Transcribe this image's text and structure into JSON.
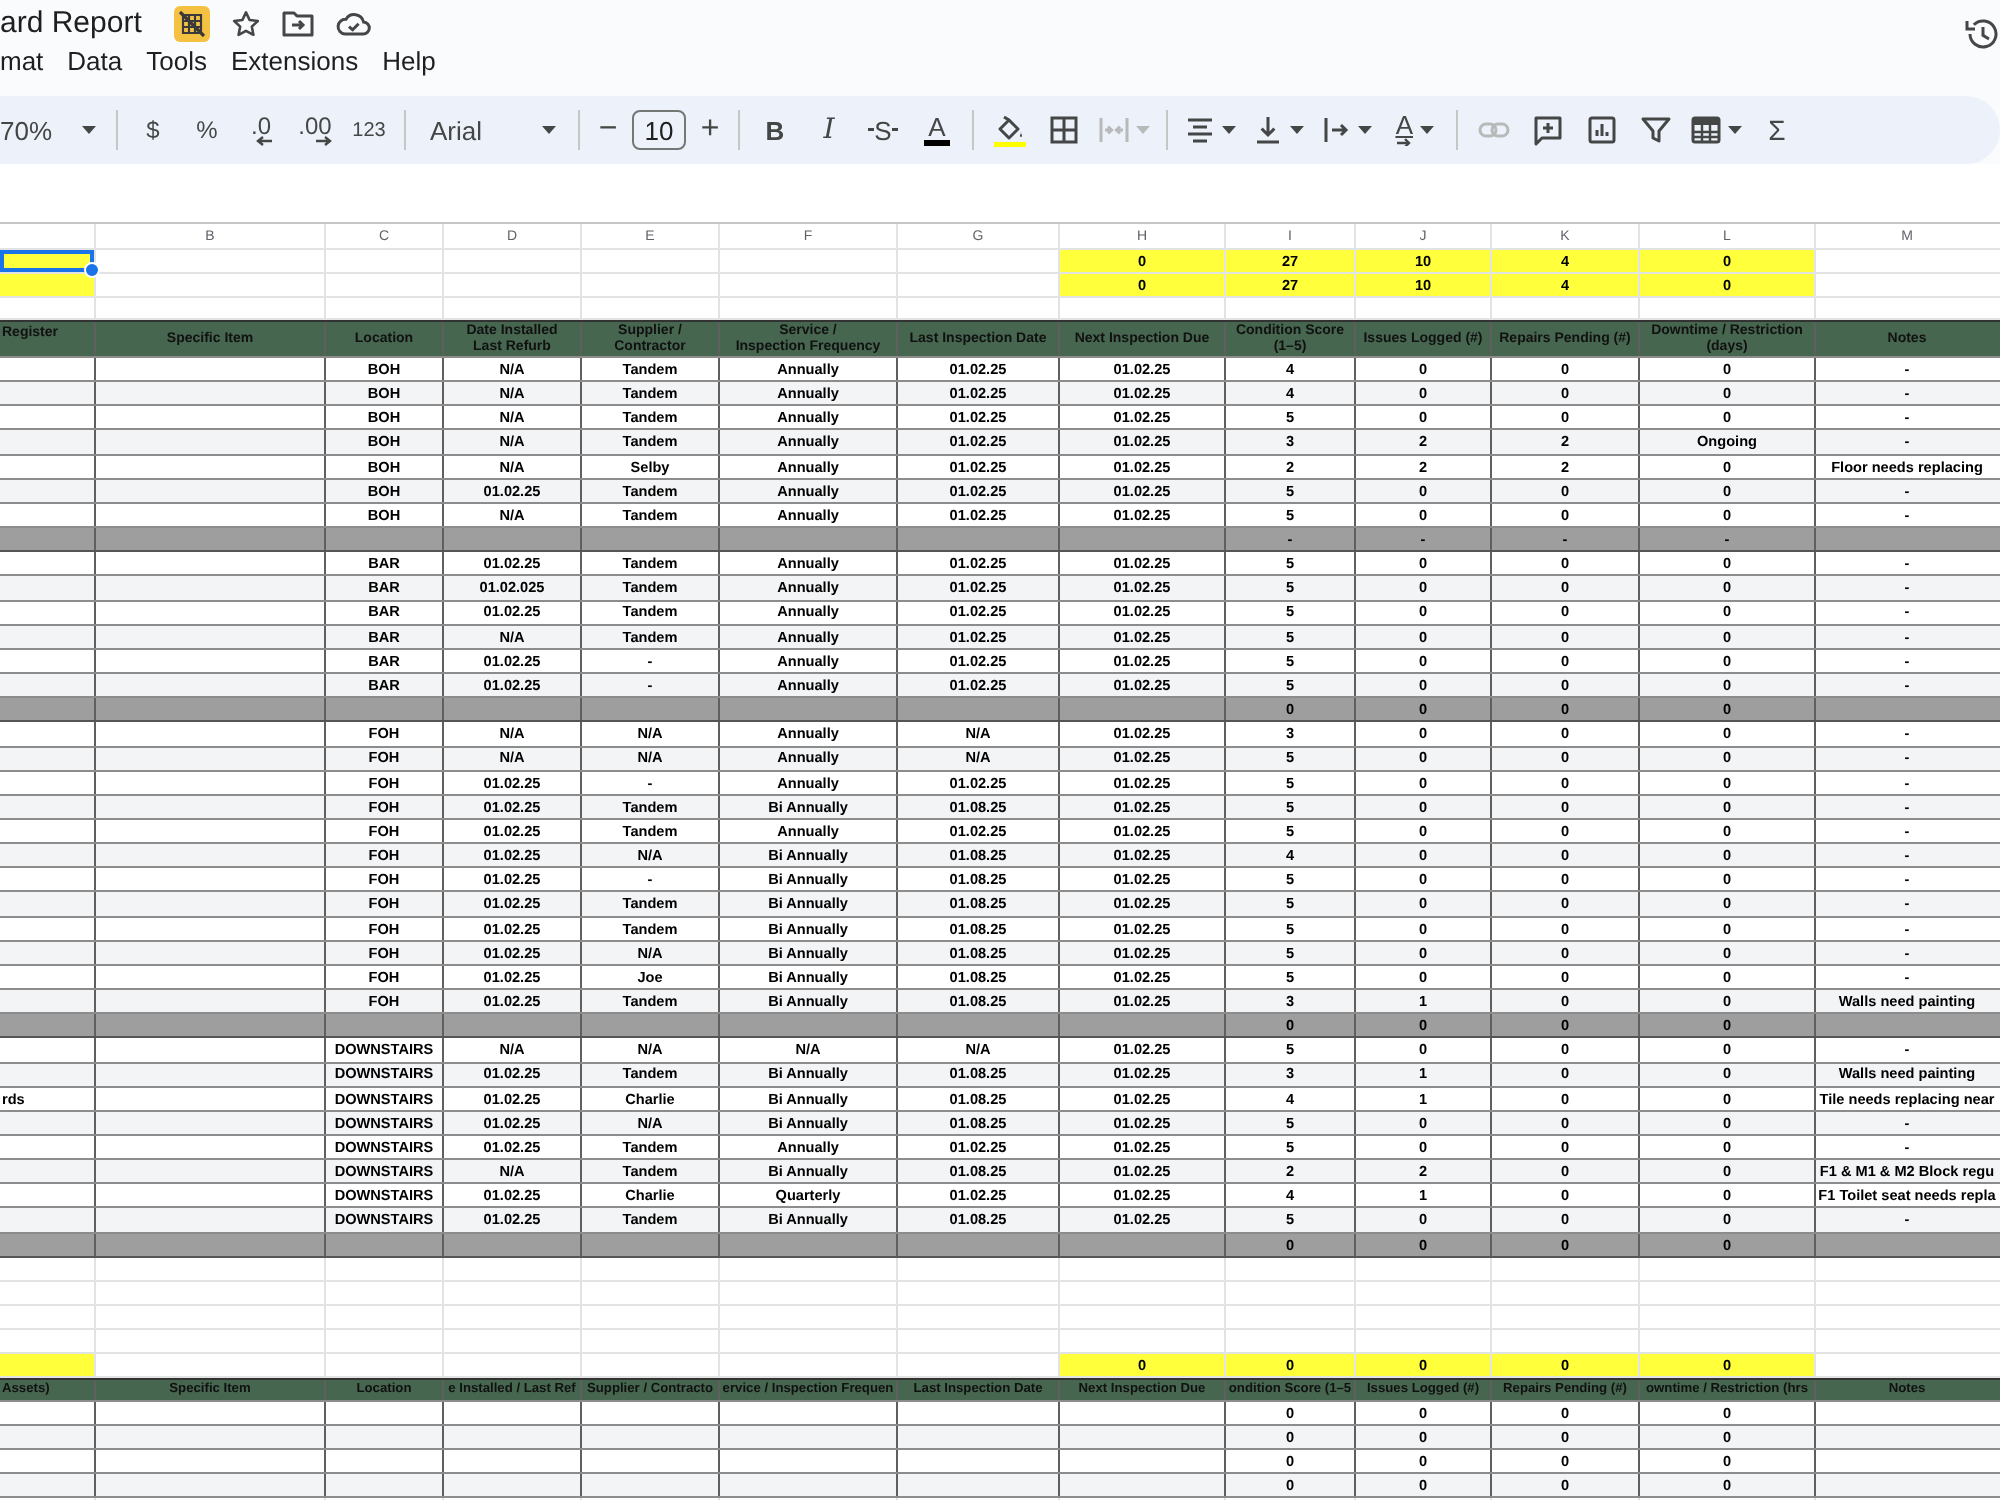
{
  "document": {
    "title": "ard Report"
  },
  "menu": [
    "mat",
    "Data",
    "Tools",
    "Extensions",
    "Help"
  ],
  "toolbar": [
    [
      {
        "kind": "zoom",
        "label": "70%",
        "dropdown": true,
        "disabled": false
      }
    ],
    [
      {
        "kind": "currency",
        "label": "$",
        "disabled": false
      },
      {
        "kind": "percent",
        "label": "%",
        "disabled": false
      },
      {
        "kind": "decimal_less",
        "label": ".0",
        "disabled": false
      },
      {
        "kind": "decimal_more",
        "label": ".00",
        "disabled": false
      },
      {
        "kind": "number_format",
        "label": "123",
        "disabled": false
      }
    ],
    [
      {
        "kind": "font",
        "label": "Arial",
        "dropdown": true,
        "disabled": false
      }
    ],
    [
      {
        "kind": "size_down",
        "label": "−",
        "disabled": false
      },
      {
        "kind": "size",
        "label": "10",
        "disabled": false
      },
      {
        "kind": "size_up",
        "label": "+",
        "disabled": false
      }
    ],
    [
      {
        "kind": "bold",
        "label": "B",
        "disabled": false
      },
      {
        "kind": "italic",
        "label": "I",
        "disabled": false
      },
      {
        "kind": "strike",
        "label": "S",
        "disabled": false
      },
      {
        "kind": "text_color",
        "label": "A",
        "disabled": false
      }
    ],
    [
      {
        "kind": "fill",
        "disabled": false
      },
      {
        "kind": "borders",
        "disabled": false
      },
      {
        "kind": "merge",
        "dropdown": true,
        "disabled": true
      }
    ],
    [
      {
        "kind": "align",
        "dropdown": true,
        "disabled": false
      },
      {
        "kind": "valign",
        "dropdown": true,
        "disabled": false
      },
      {
        "kind": "wrap",
        "dropdown": true,
        "disabled": false
      },
      {
        "kind": "rotate",
        "label": "A",
        "dropdown": true,
        "disabled": false
      }
    ],
    [
      {
        "kind": "link",
        "disabled": true
      },
      {
        "kind": "comment",
        "disabled": false
      },
      {
        "kind": "chart",
        "disabled": false
      },
      {
        "kind": "filter",
        "disabled": false
      },
      {
        "kind": "table",
        "dropdown": true,
        "disabled": false
      },
      {
        "kind": "functions",
        "label": "Σ",
        "disabled": false
      }
    ]
  ],
  "sheet": {
    "column_headers": [
      "B",
      "C",
      "D",
      "E",
      "F",
      "G",
      "H",
      "I",
      "J",
      "K",
      "L",
      "M"
    ],
    "summary": [
      {
        "selected": true,
        "values": [
          "0",
          "27",
          "10",
          "4",
          "0"
        ]
      },
      {
        "selected": false,
        "values": [
          "0",
          "27",
          "10",
          "4",
          "0"
        ]
      }
    ],
    "table": {
      "columns": [
        "Register",
        "Specific Item",
        "Location",
        "Date Installed\nLast Refurb",
        "Supplier /\nContractor",
        "Service /\nInspection Frequency",
        "Last Inspection Date",
        "Next Inspection Due",
        "Condition Score\n(1–5)",
        "Issues Logged (#)",
        "Repairs Pending (#)",
        "Downtime / Restriction\n(days)",
        "Notes"
      ],
      "sections": [
        {
          "rows": [
            {
              "cells": [
                "BOH",
                "N/A",
                "Tandem",
                "Annually",
                "01.02.25",
                "01.02.25",
                "4",
                "0",
                "0",
                "0",
                "-"
              ]
            },
            {
              "cells": [
                "BOH",
                "N/A",
                "Tandem",
                "Annually",
                "01.02.25",
                "01.02.25",
                "4",
                "0",
                "0",
                "0",
                "-"
              ]
            },
            {
              "cells": [
                "BOH",
                "N/A",
                "Tandem",
                "Annually",
                "01.02.25",
                "01.02.25",
                "5",
                "0",
                "0",
                "0",
                "-"
              ]
            },
            {
              "cells": [
                "BOH",
                "N/A",
                "Tandem",
                "Annually",
                "01.02.25",
                "01.02.25",
                "3",
                "2",
                "2",
                "Ongoing",
                "-"
              ]
            },
            {
              "cells": [
                "BOH",
                "N/A",
                "Selby",
                "Annually",
                "01.02.25",
                "01.02.25",
                "2",
                "2",
                "2",
                "0",
                "Floor needs replacing"
              ]
            },
            {
              "cells": [
                "BOH",
                "01.02.25",
                "Tandem",
                "Annually",
                "01.02.25",
                "01.02.25",
                "5",
                "0",
                "0",
                "0",
                "-"
              ]
            },
            {
              "cells": [
                "BOH",
                "N/A",
                "Tandem",
                "Annually",
                "01.02.25",
                "01.02.25",
                "5",
                "0",
                "0",
                "0",
                "-"
              ]
            }
          ],
          "totals": [
            "-",
            "-",
            "-",
            "-"
          ]
        },
        {
          "rows": [
            {
              "cells": [
                "BAR",
                "01.02.25",
                "Tandem",
                "Annually",
                "01.02.25",
                "01.02.25",
                "5",
                "0",
                "0",
                "0",
                "-"
              ]
            },
            {
              "cells": [
                "BAR",
                "01.02.025",
                "Tandem",
                "Annually",
                "01.02.25",
                "01.02.25",
                "5",
                "0",
                "0",
                "0",
                "-"
              ]
            },
            {
              "cells": [
                "BAR",
                "01.02.25",
                "Tandem",
                "Annually",
                "01.02.25",
                "01.02.25",
                "5",
                "0",
                "0",
                "0",
                "-"
              ]
            },
            {
              "cells": [
                "BAR",
                "N/A",
                "Tandem",
                "Annually",
                "01.02.25",
                "01.02.25",
                "5",
                "0",
                "0",
                "0",
                "-"
              ]
            },
            {
              "cells": [
                "BAR",
                "01.02.25",
                "-",
                "Annually",
                "01.02.25",
                "01.02.25",
                "5",
                "0",
                "0",
                "0",
                "-"
              ]
            },
            {
              "cells": [
                "BAR",
                "01.02.25",
                "-",
                "Annually",
                "01.02.25",
                "01.02.25",
                "5",
                "0",
                "0",
                "0",
                "-"
              ]
            }
          ],
          "totals": [
            "0",
            "0",
            "0",
            "0"
          ]
        },
        {
          "rows": [
            {
              "cells": [
                "FOH",
                "N/A",
                "N/A",
                "Annually",
                "N/A",
                "01.02.25",
                "3",
                "0",
                "0",
                "0",
                "-"
              ]
            },
            {
              "cells": [
                "FOH",
                "N/A",
                "N/A",
                "Annually",
                "N/A",
                "01.02.25",
                "5",
                "0",
                "0",
                "0",
                "-"
              ]
            },
            {
              "cells": [
                "FOH",
                "01.02.25",
                "-",
                "Annually",
                "01.02.25",
                "01.02.25",
                "5",
                "0",
                "0",
                "0",
                "-"
              ]
            },
            {
              "cells": [
                "FOH",
                "01.02.25",
                "Tandem",
                "Bi Annually",
                "01.08.25",
                "01.02.25",
                "5",
                "0",
                "0",
                "0",
                "-"
              ]
            },
            {
              "cells": [
                "FOH",
                "01.02.25",
                "Tandem",
                "Annually",
                "01.02.25",
                "01.02.25",
                "5",
                "0",
                "0",
                "0",
                "-"
              ]
            },
            {
              "cells": [
                "FOH",
                "01.02.25",
                "N/A",
                "Bi Annually",
                "01.08.25",
                "01.02.25",
                "4",
                "0",
                "0",
                "0",
                "-"
              ]
            },
            {
              "cells": [
                "FOH",
                "01.02.25",
                "-",
                "Bi Annually",
                "01.08.25",
                "01.02.25",
                "5",
                "0",
                "0",
                "0",
                "-"
              ]
            },
            {
              "cells": [
                "FOH",
                "01.02.25",
                "Tandem",
                "Bi Annually",
                "01.08.25",
                "01.02.25",
                "5",
                "0",
                "0",
                "0",
                "-"
              ]
            },
            {
              "cells": [
                "FOH",
                "01.02.25",
                "Tandem",
                "Bi Annually",
                "01.08.25",
                "01.02.25",
                "5",
                "0",
                "0",
                "0",
                "-"
              ]
            },
            {
              "cells": [
                "FOH",
                "01.02.25",
                "N/A",
                "Bi Annually",
                "01.08.25",
                "01.02.25",
                "5",
                "0",
                "0",
                "0",
                "-"
              ]
            },
            {
              "cells": [
                "FOH",
                "01.02.25",
                "Joe",
                "Bi Annually",
                "01.08.25",
                "01.02.25",
                "5",
                "0",
                "0",
                "0",
                "-"
              ]
            },
            {
              "cells": [
                "FOH",
                "01.02.25",
                "Tandem",
                "Bi Annually",
                "01.08.25",
                "01.02.25",
                "3",
                "1",
                "0",
                "0",
                "Walls need painting"
              ]
            }
          ],
          "totals": [
            "0",
            "0",
            "0",
            "0"
          ]
        },
        {
          "rows": [
            {
              "cells": [
                "DOWNSTAIRS",
                "N/A",
                "N/A",
                "N/A",
                "N/A",
                "01.02.25",
                "5",
                "0",
                "0",
                "0",
                "-"
              ]
            },
            {
              "cells": [
                "DOWNSTAIRS",
                "01.02.25",
                "Tandem",
                "Bi Annually",
                "01.08.25",
                "01.02.25",
                "3",
                "1",
                "0",
                "0",
                "Walls need painting"
              ]
            },
            {
              "column_a": "rds",
              "cells": [
                "DOWNSTAIRS",
                "01.02.25",
                "Charlie",
                "Bi Annually",
                "01.08.25",
                "01.02.25",
                "4",
                "1",
                "0",
                "0",
                "Tile needs replacing near"
              ]
            },
            {
              "cells": [
                "DOWNSTAIRS",
                "01.02.25",
                "N/A",
                "Bi Annually",
                "01.08.25",
                "01.02.25",
                "5",
                "0",
                "0",
                "0",
                "-"
              ]
            },
            {
              "cells": [
                "DOWNSTAIRS",
                "01.02.25",
                "Tandem",
                "Annually",
                "01.02.25",
                "01.02.25",
                "5",
                "0",
                "0",
                "0",
                "-"
              ]
            },
            {
              "cells": [
                "DOWNSTAIRS",
                "N/A",
                "Tandem",
                "Bi Annually",
                "01.08.25",
                "01.02.25",
                "2",
                "2",
                "0",
                "0",
                "F1 & M1 & M2 Block regu"
              ]
            },
            {
              "cells": [
                "DOWNSTAIRS",
                "01.02.25",
                "Charlie",
                "Quarterly",
                "01.02.25",
                "01.02.25",
                "4",
                "1",
                "0",
                "0",
                "F1 Toilet seat needs repla"
              ]
            },
            {
              "cells": [
                "DOWNSTAIRS",
                "01.02.25",
                "Tandem",
                "Bi Annually",
                "01.08.25",
                "01.02.25",
                "5",
                "0",
                "0",
                "0",
                "-"
              ]
            }
          ],
          "totals": [
            "0",
            "0",
            "0",
            "0"
          ]
        }
      ]
    },
    "lower_summary": {
      "values": [
        "0",
        "0",
        "0",
        "0",
        "0"
      ]
    },
    "lower_table": {
      "columns": [
        "Assets)",
        "Specific Item",
        "Location",
        "e Installed / Last Ref",
        "Supplier / Contracto",
        "ervice / Inspection Frequen",
        "Last Inspection Date",
        "Next Inspection Due",
        "ondition Score (1–5",
        "Issues Logged (#)",
        "Repairs Pending (#)",
        "owntime / Restriction (hrs",
        "Notes"
      ],
      "rows": [
        [
          "0",
          "0",
          "0",
          "0"
        ],
        [
          "0",
          "0",
          "0",
          "0"
        ],
        [
          "0",
          "0",
          "0",
          "0"
        ],
        [
          "0",
          "0",
          "0",
          "0"
        ]
      ]
    }
  }
}
